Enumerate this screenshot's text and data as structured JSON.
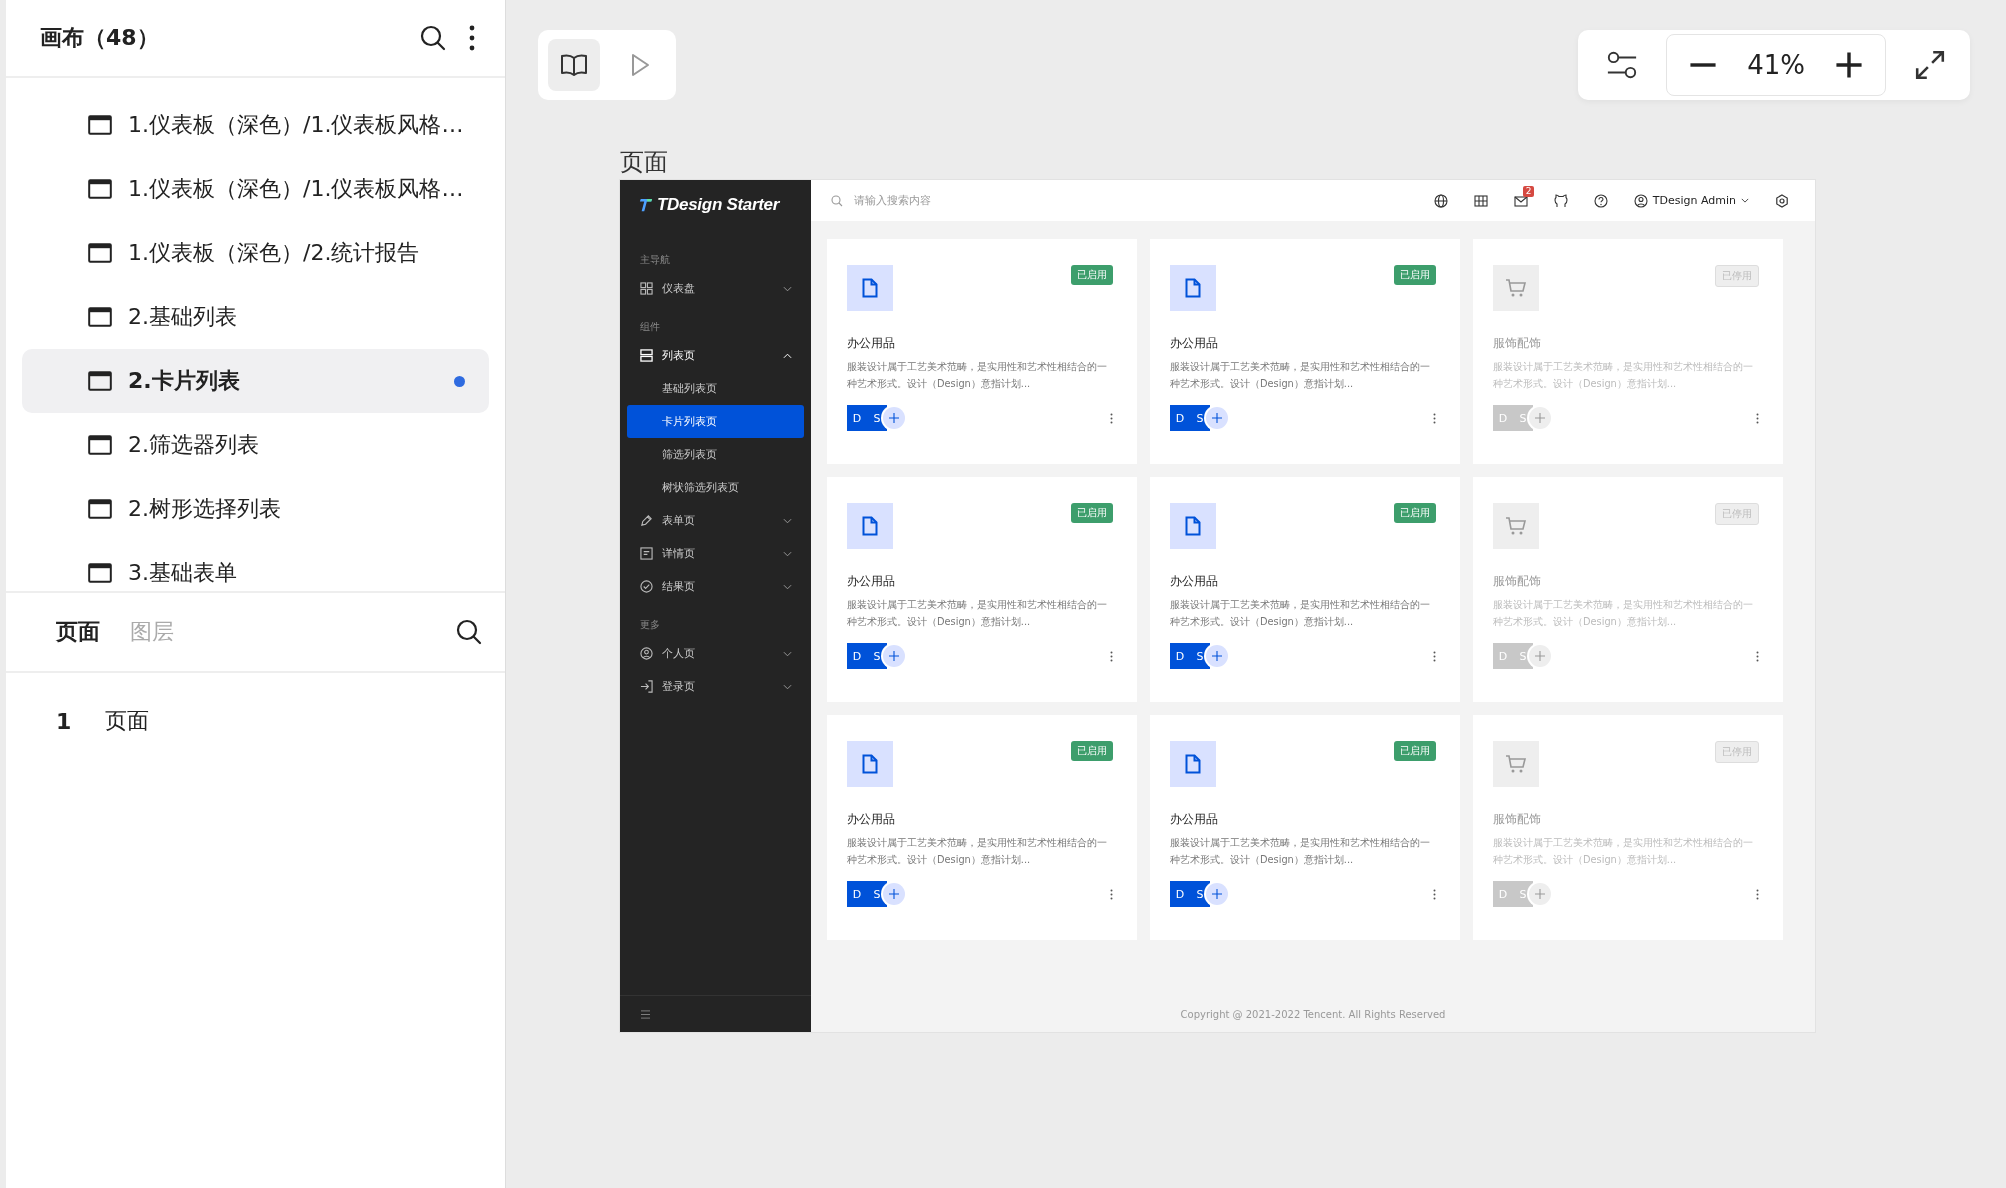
{
  "canvas_panel": {
    "title": "画布（48）",
    "items": [
      {
        "label": "1.仪表板（深色）/1.仪表板风格…",
        "selected": false,
        "dot": false
      },
      {
        "label": "1.仪表板（深色）/1.仪表板风格…",
        "selected": false,
        "dot": false
      },
      {
        "label": "1.仪表板（深色）/2.统计报告",
        "selected": false,
        "dot": false
      },
      {
        "label": "2.基础列表",
        "selected": false,
        "dot": false
      },
      {
        "label": "2.卡片列表",
        "selected": true,
        "dot": true
      },
      {
        "label": "2.筛选器列表",
        "selected": false,
        "dot": false
      },
      {
        "label": "2.树形选择列表",
        "selected": false,
        "dot": false
      },
      {
        "label": "3.基础表单",
        "selected": false,
        "dot": false
      }
    ]
  },
  "bottom_tabs": [
    {
      "label": "页面",
      "selected": true
    },
    {
      "label": "图层",
      "selected": false
    }
  ],
  "pages": [
    {
      "number": "1",
      "label": "页面"
    }
  ],
  "view_modes": [
    {
      "selected": true
    },
    {
      "selected": false
    }
  ],
  "zoom": "41%",
  "frame_label": "页面",
  "app": {
    "logo": "TDesign Starter",
    "nav": [
      {
        "kind": "group",
        "label": "主导航"
      },
      {
        "kind": "item",
        "label": "仪表盘",
        "expanded": false
      },
      {
        "kind": "group",
        "label": "组件"
      },
      {
        "kind": "item",
        "label": "列表页",
        "expanded": true
      },
      {
        "kind": "sub",
        "label": "基础列表页",
        "selected": false
      },
      {
        "kind": "sub",
        "label": "卡片列表页",
        "selected": true
      },
      {
        "kind": "sub",
        "label": "筛选列表页",
        "selected": false
      },
      {
        "kind": "sub",
        "label": "树状筛选列表页",
        "selected": false
      },
      {
        "kind": "item",
        "label": "表单页",
        "expanded": false
      },
      {
        "kind": "item",
        "label": "详情页",
        "expanded": false
      },
      {
        "kind": "item",
        "label": "结果页",
        "expanded": false
      },
      {
        "kind": "group",
        "label": "更多"
      },
      {
        "kind": "item",
        "label": "个人页",
        "expanded": false
      },
      {
        "kind": "item",
        "label": "登录页",
        "expanded": false
      }
    ],
    "search": {
      "placeholder": "请输入搜索内容"
    },
    "mail_badge": "2",
    "user": "TDesign Admin",
    "cards": [
      {
        "kind": "document",
        "title": "办公用品",
        "description": "服装设计属于工艺美术范畴，是实用性和艺术性相结合的一种艺术形式。设计（Design）意指计划...",
        "status": "已启用",
        "enabled": true,
        "avatars": [
          "D",
          "S"
        ]
      },
      {
        "kind": "document",
        "title": "办公用品",
        "description": "服装设计属于工艺美术范畴，是实用性和艺术性相结合的一种艺术形式。设计（Design）意指计划...",
        "status": "已启用",
        "enabled": true,
        "avatars": [
          "D",
          "S"
        ]
      },
      {
        "kind": "cart",
        "title": "服饰配饰",
        "description": "服装设计属于工艺美术范畴，是实用性和艺术性相结合的一种艺术形式。设计（Design）意指计划...",
        "status": "已停用",
        "enabled": false,
        "avatars": [
          "D",
          "S"
        ]
      },
      {
        "kind": "document",
        "title": "办公用品",
        "description": "服装设计属于工艺美术范畴，是实用性和艺术性相结合的一种艺术形式。设计（Design）意指计划...",
        "status": "已启用",
        "enabled": true,
        "avatars": [
          "D",
          "S"
        ]
      },
      {
        "kind": "document",
        "title": "办公用品",
        "description": "服装设计属于工艺美术范畴，是实用性和艺术性相结合的一种艺术形式。设计（Design）意指计划...",
        "status": "已启用",
        "enabled": true,
        "avatars": [
          "D",
          "S"
        ]
      },
      {
        "kind": "cart",
        "title": "服饰配饰",
        "description": "服装设计属于工艺美术范畴，是实用性和艺术性相结合的一种艺术形式。设计（Design）意指计划...",
        "status": "已停用",
        "enabled": false,
        "avatars": [
          "D",
          "S"
        ]
      },
      {
        "kind": "document",
        "title": "办公用品",
        "description": "服装设计属于工艺美术范畴，是实用性和艺术性相结合的一种艺术形式。设计（Design）意指计划...",
        "status": "已启用",
        "enabled": true,
        "avatars": [
          "D",
          "S"
        ]
      },
      {
        "kind": "document",
        "title": "办公用品",
        "description": "服装设计属于工艺美术范畴，是实用性和艺术性相结合的一种艺术形式。设计（Design）意指计划...",
        "status": "已启用",
        "enabled": true,
        "avatars": [
          "D",
          "S"
        ]
      },
      {
        "kind": "cart",
        "title": "服饰配饰",
        "description": "服装设计属于工艺美术范畴，是实用性和艺术性相结合的一种艺术形式。设计（Design）意指计划...",
        "status": "已停用",
        "enabled": false,
        "avatars": [
          "D",
          "S"
        ]
      }
    ],
    "footer": "Copyright @ 2021-2022 Tencent. All Rights Reserved"
  }
}
